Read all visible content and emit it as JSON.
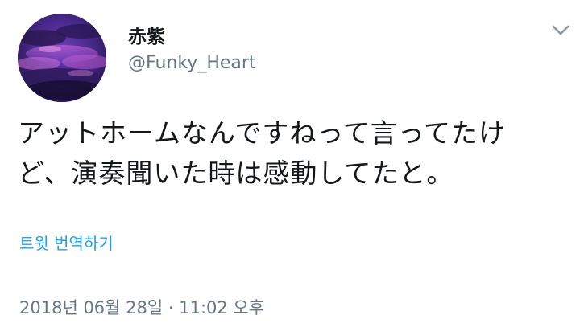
{
  "tweet": {
    "author": {
      "display_name": "赤紫",
      "handle": "@Funky_Heart",
      "avatar_icon": "purple-cloud-sky-avatar"
    },
    "menu_icon": "chevron-down-icon",
    "text_lines": [
      "アットホームなんですねって言ってたけ",
      "ど、演奏聞いた時は感動してたと。"
    ],
    "translate_label": "트윗 번역하기",
    "timestamp": "2018년 06월 28일 · 11:02 오후"
  },
  "colors": {
    "text_primary": "#14171a",
    "text_secondary": "#657786",
    "link": "#1da1f2"
  }
}
